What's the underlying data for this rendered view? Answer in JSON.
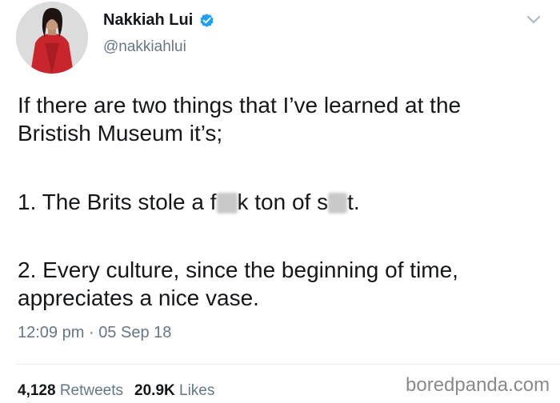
{
  "author": {
    "display_name": "Nakkiah Lui",
    "handle": "@nakkiahlui",
    "verified_icon": "verified-badge-icon",
    "verified_color": "#1da1f2"
  },
  "tweet": {
    "line1": "If there are two things that I’ve learned at the",
    "line2": "Bristish Museum it’s;",
    "line3_start": "1. The Brits stole a f",
    "line3_mid": "k ton of s",
    "line3_end": "t.",
    "line4": "2. Every culture, since the beginning of time,",
    "line5": "appreciates a nice vase."
  },
  "timestamp": {
    "time": "12:09 pm",
    "separator": "·",
    "date": "05 Sep 18"
  },
  "stats": {
    "retweets_count": "4,128",
    "retweets_label": "Retweets",
    "likes_count": "20.9K",
    "likes_label": "Likes"
  },
  "watermark": "boredpanda.com",
  "colors": {
    "text": "#14171a",
    "secondary": "#657786",
    "avatar_coat": "#c8262c"
  }
}
